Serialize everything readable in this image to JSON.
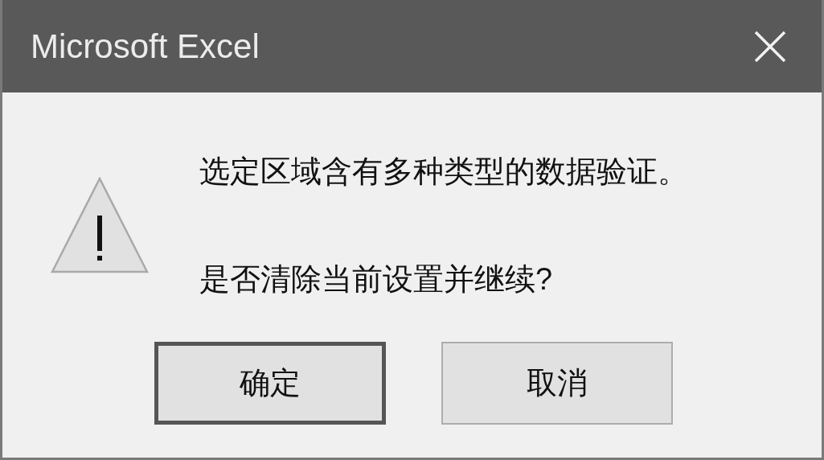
{
  "window": {
    "title": "Microsoft Excel"
  },
  "message": [
    "选定区域含有多种类型的数据验证。",
    "是否清除当前设置并继续?"
  ],
  "buttons": [
    {
      "label": "确定",
      "default": true
    },
    {
      "label": "取消",
      "default": false
    }
  ]
}
